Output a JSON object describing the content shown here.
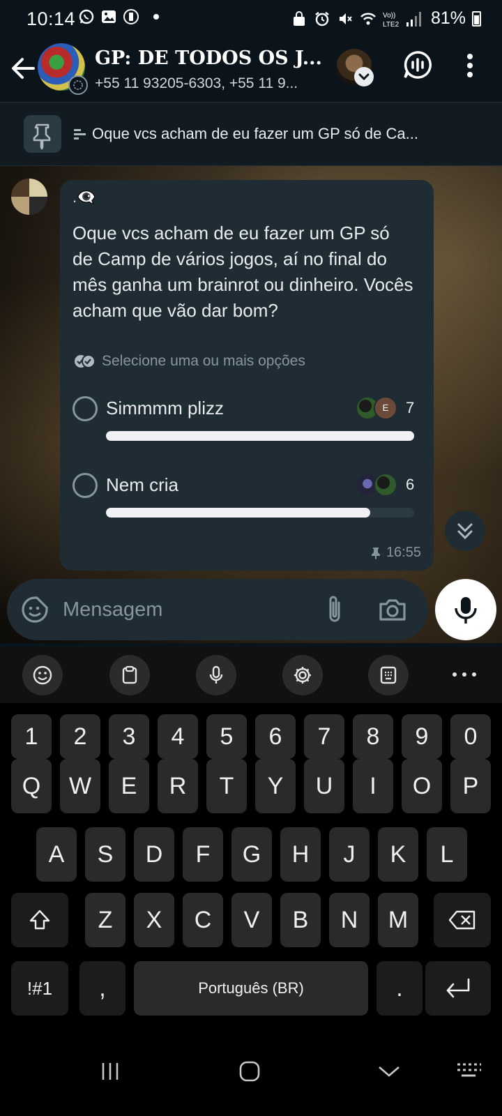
{
  "status_bar": {
    "time": "10:14",
    "battery": "81%"
  },
  "header": {
    "title": "GP: DE TODOS OS J...",
    "subtitle": "+55 11 93205-6303, +55 11 9..."
  },
  "pinned": {
    "text": "Oque vcs acham de eu fazer um GP só de Ca..."
  },
  "message": {
    "sender": ".👁‍🗨",
    "question": "Oque vcs acham de eu fazer um GP só de Camp de vários jogos, aí no final do mês ganha um brainrot ou dinheiro. Vocês acham que vão dar bom?",
    "hint": "Selecione uma ou mais opções",
    "time": "16:55",
    "options": [
      {
        "label": "Simmmm plizz",
        "count": "7",
        "votes": 7
      },
      {
        "label": "Nem cria",
        "count": "6",
        "votes": 6
      }
    ],
    "voter_initial": "E"
  },
  "composer": {
    "placeholder": "Mensagem"
  },
  "keyboard": {
    "row_numbers": [
      "1",
      "2",
      "3",
      "4",
      "5",
      "6",
      "7",
      "8",
      "9",
      "0"
    ],
    "row_1": [
      "Q",
      "W",
      "E",
      "R",
      "T",
      "Y",
      "U",
      "I",
      "O",
      "P"
    ],
    "row_2": [
      "A",
      "S",
      "D",
      "F",
      "G",
      "H",
      "J",
      "K",
      "L"
    ],
    "row_3": [
      "Z",
      "X",
      "C",
      "V",
      "B",
      "N",
      "M"
    ],
    "symbols_key": "!#1",
    "comma_key": ",",
    "space_key": "Português (BR)",
    "period_key": "."
  },
  "colors": {
    "bubble": "#202c33",
    "background": "#0b141a",
    "accent": "#f0f2f5"
  }
}
